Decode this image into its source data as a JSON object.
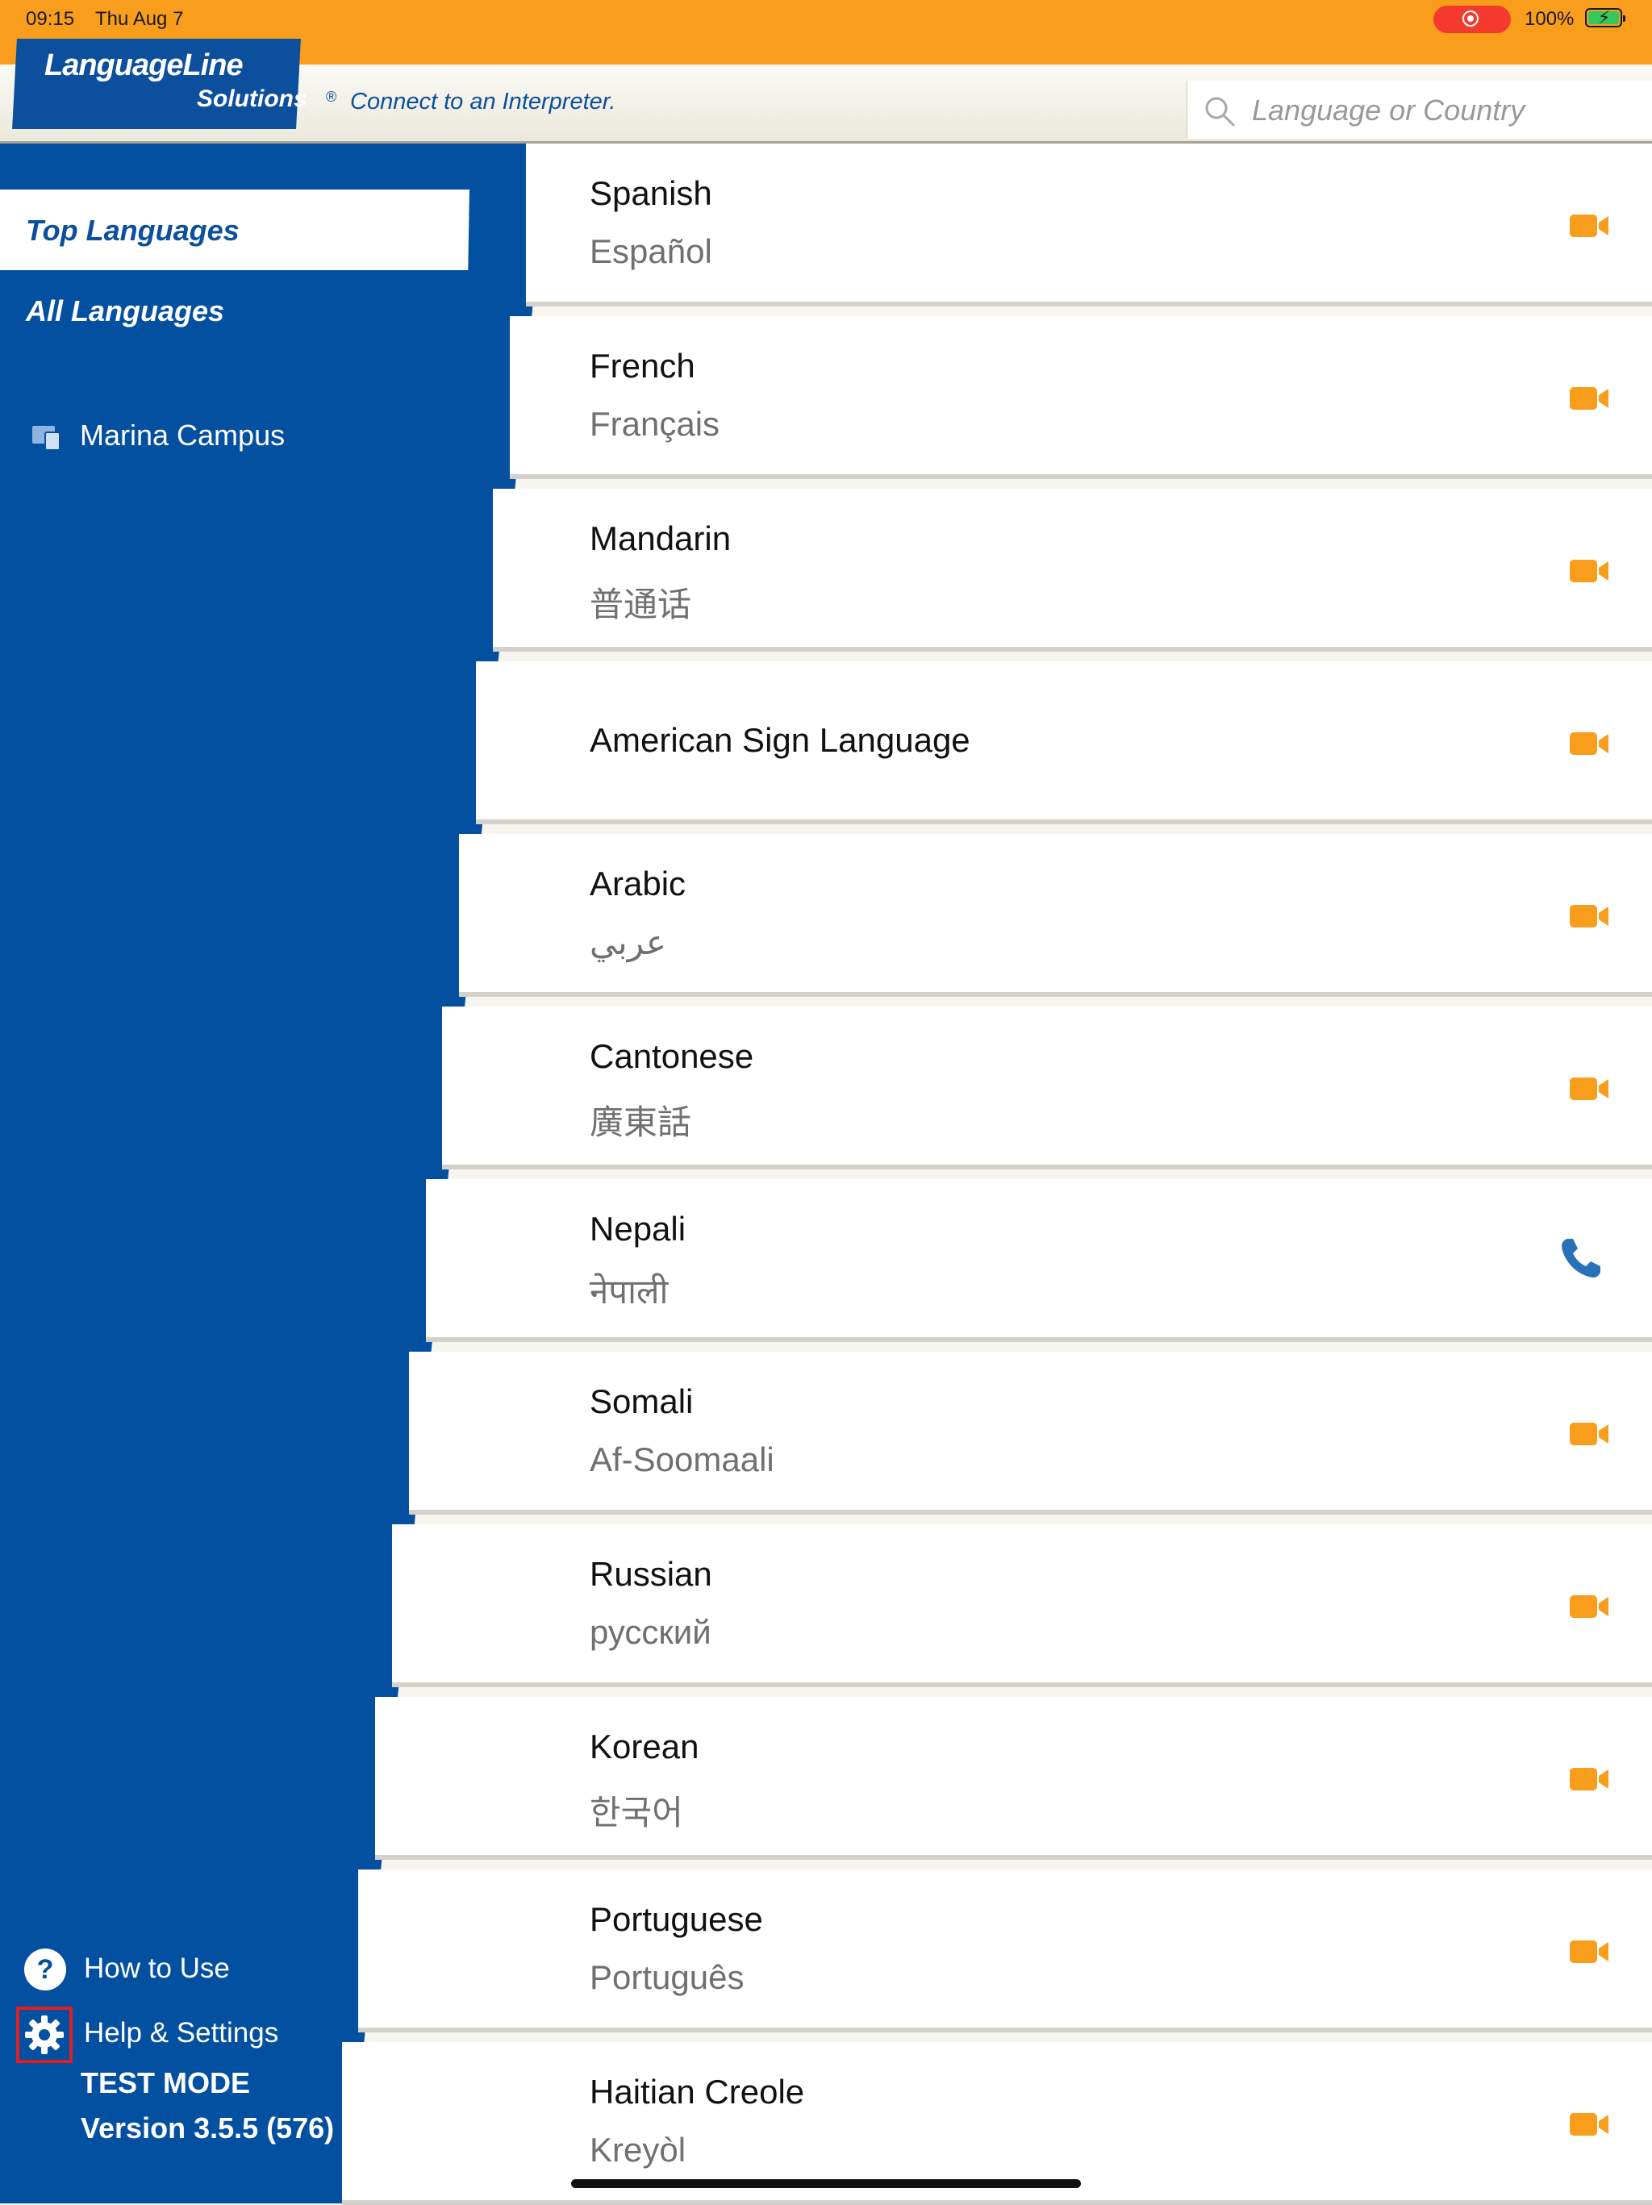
{
  "status_bar": {
    "time": "09:15",
    "date": "Thu Aug 7",
    "battery_percent": "100%",
    "screen_recording": true,
    "record_color": "#f43a2c",
    "bar_color": "#f89d1c"
  },
  "header": {
    "logo_line1": "LanguageLine",
    "logo_line2": "Solutions",
    "logo_reg": "®",
    "tagline": "Connect to an Interpreter.",
    "search_placeholder": "Language or Country",
    "brand_color": "#0450a0"
  },
  "sidebar": {
    "nav": [
      {
        "label": "Top Languages",
        "selected": true
      },
      {
        "label": "All Languages",
        "selected": false
      }
    ],
    "location": {
      "label": "Marina Campus",
      "icon": "devices-icon"
    },
    "how_to_use": {
      "label": "How to Use",
      "icon": "question-icon"
    },
    "help_settings": {
      "label": "Help & Settings",
      "icon": "gear-icon"
    },
    "test_mode": "TEST MODE",
    "version": "Version 3.5.5 (576)"
  },
  "languages": [
    {
      "name": "Spanish",
      "native": "Español",
      "call_type": "video",
      "icon": "video-camera-icon"
    },
    {
      "name": "French",
      "native": "Français",
      "call_type": "video",
      "icon": "video-camera-icon"
    },
    {
      "name": "Mandarin",
      "native": "普通话",
      "call_type": "video",
      "icon": "video-camera-icon"
    },
    {
      "name": "American Sign Language",
      "native": "",
      "call_type": "video",
      "icon": "video-camera-icon"
    },
    {
      "name": "Arabic",
      "native": "عربي",
      "call_type": "video",
      "icon": "video-camera-icon"
    },
    {
      "name": "Cantonese",
      "native": "廣東話",
      "call_type": "video",
      "icon": "video-camera-icon"
    },
    {
      "name": "Nepali",
      "native": "नेपाली",
      "call_type": "audio",
      "icon": "phone-icon"
    },
    {
      "name": "Somali",
      "native": "Af-Soomaali",
      "call_type": "video",
      "icon": "video-camera-icon"
    },
    {
      "name": "Russian",
      "native": "русский",
      "call_type": "video",
      "icon": "video-camera-icon"
    },
    {
      "name": "Korean",
      "native": "한국어",
      "call_type": "video",
      "icon": "video-camera-icon"
    },
    {
      "name": "Portuguese",
      "native": "Português",
      "call_type": "video",
      "icon": "video-camera-icon"
    },
    {
      "name": "Haitian Creole",
      "native": "Kreyòl",
      "call_type": "video",
      "icon": "video-camera-icon"
    }
  ],
  "colors": {
    "video_icon": "#f89d1c",
    "phone_icon": "#2a72b8",
    "settings_highlight": "#e02020"
  }
}
